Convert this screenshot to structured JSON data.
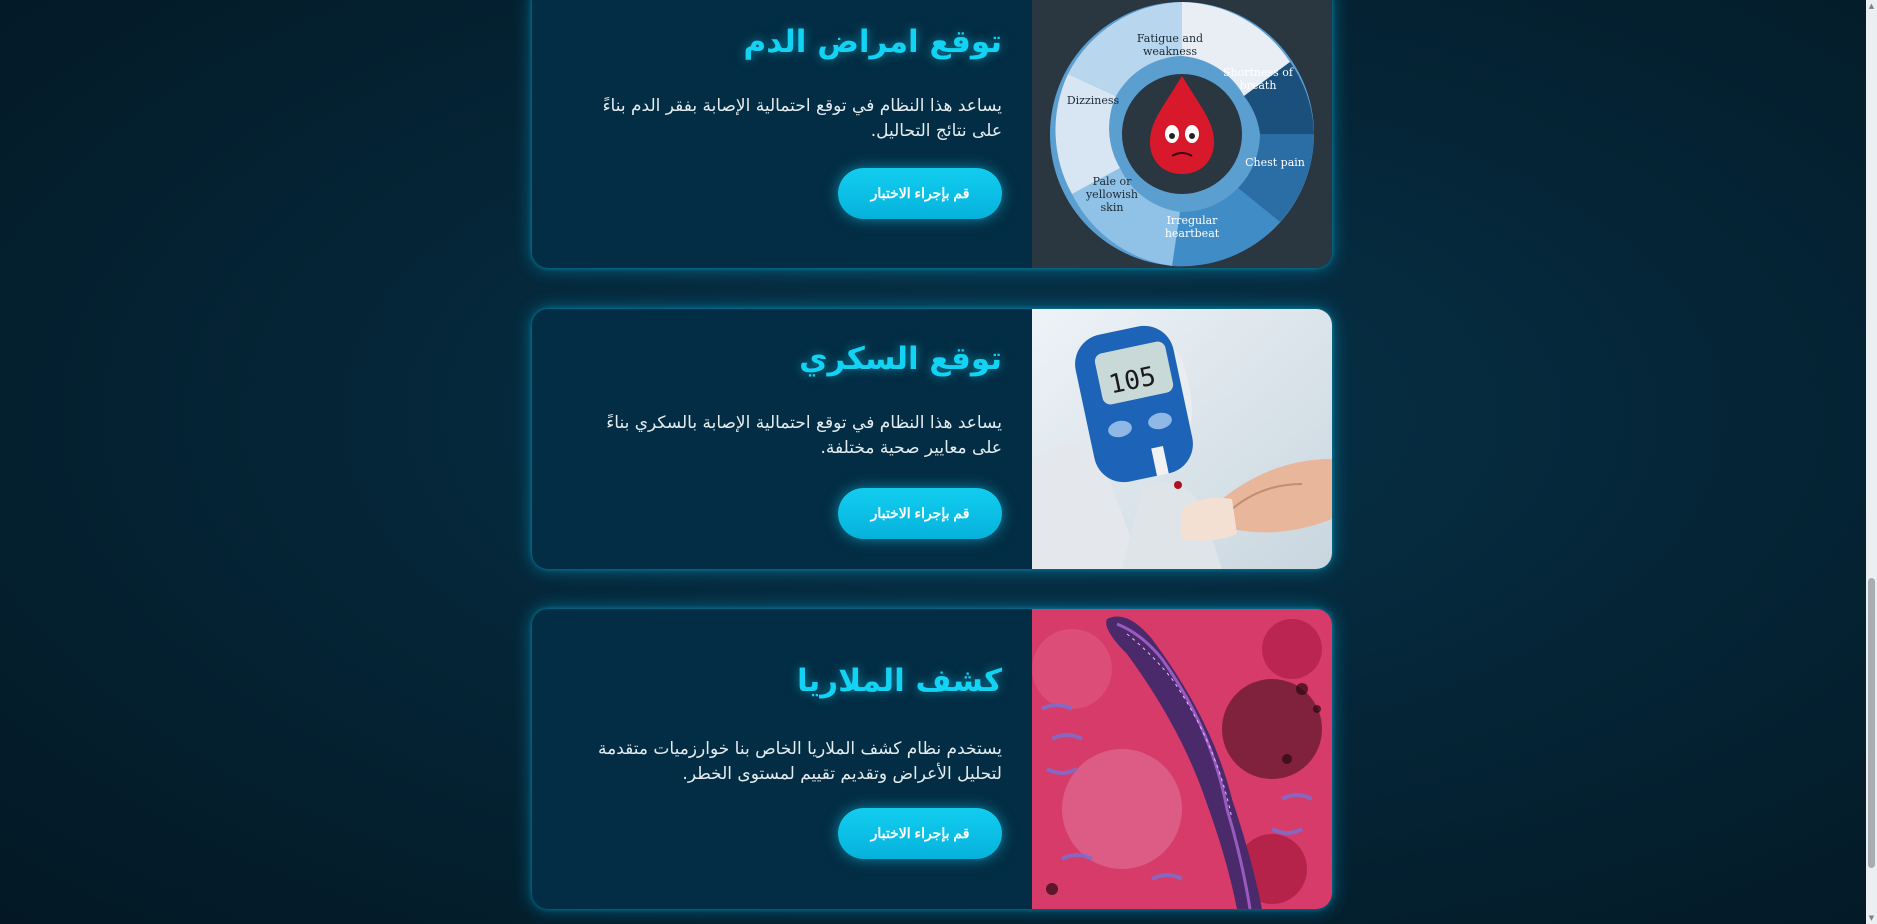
{
  "cards": [
    {
      "title": "توقع امراض الدم",
      "description_line1": "يساعد هذا النظام في توقع احتمالية الإصابة بفقر الدم بناءً",
      "description_line2": "على نتائج التحاليل.",
      "button_label": "قم بإجراء الاختبار",
      "image": {
        "type": "anemia-symptoms-diagram",
        "labels": [
          "Fatigue and weakness",
          "Shortness of breath",
          "Chest pain",
          "Irregular heartbeat",
          "Pale or yellowish skin",
          "Dizziness"
        ]
      }
    },
    {
      "title": "توقع السكري",
      "description_line1": "يساعد هذا النظام في توقع احتمالية الإصابة بالسكري بناءً",
      "description_line2": "على معايير صحية مختلفة.",
      "button_label": "قم بإجراء الاختبار",
      "image": {
        "type": "glucose-meter-photo",
        "meter_reading": "105"
      }
    },
    {
      "title": "كشف الملاريا",
      "description_line1": "يستخدم نظام كشف الملاريا الخاص بنا خوارزميات متقدمة",
      "description_line2": "لتحليل الأعراض وتقديم تقييم لمستوى الخطر.",
      "button_label": "قم بإجراء الاختبار",
      "image": {
        "type": "malaria-parasite-micrograph"
      }
    }
  ],
  "colors": {
    "accent": "#12d3f3",
    "card_bg": "#032d44",
    "page_bg": "#031a29"
  }
}
